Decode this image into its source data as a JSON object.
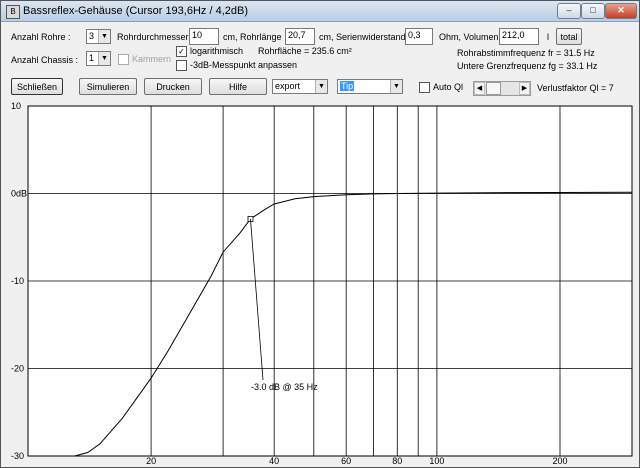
{
  "window": {
    "title": "Bassreflex-Gehäuse (Cursor 193,6Hz / 4,2dB)",
    "min_label": "–",
    "max_label": "□",
    "close_label": "✕"
  },
  "params": {
    "anzahl_rohre_label": "Anzahl Rohre :",
    "anzahl_rohre_value": "3",
    "rohrdurchmesser_label": "Rohrdurchmesser",
    "rohrdurchmesser_value": "10",
    "rohrlaenge_label": "cm, Rohrlänge",
    "rohrlaenge_value": "20,7",
    "serienwiderstand_label": "cm, Serienwiderstand",
    "serienwiderstand_value": "0,3",
    "volumen_label": "Ohm, Volumen",
    "volumen_value": "212,0",
    "volumen_unit": "l",
    "total_label": "total",
    "anzahl_chassis_label": "Anzahl Chassis :",
    "anzahl_chassis_value": "1",
    "kammern_label": "Kammern",
    "logarithmisch_label": "logarithmisch",
    "messpunkt_label": "-3dB-Messpunkt anpassen",
    "rohrflaeche_text": "Rohrfläche = 235.6 cm²",
    "abstimmfrequenz_text": "Rohrabstimmfrequenz fr = 31.5 Hz",
    "grenzfrequenz_text": "Untere Grenzfrequenz fg = 33.1 Hz"
  },
  "toolbar": {
    "schliessen": "Schließen",
    "simulieren": "Simulieren",
    "drucken": "Drucken",
    "hilfe": "Hilfe",
    "export_value": "export",
    "tip_value": "Tip",
    "auto_ql_label": "Auto Ql",
    "verlustfaktor_text": "Verlustfaktor Ql = 7"
  },
  "chart_data": {
    "type": "line",
    "xscale": "log",
    "xlim": [
      10,
      300
    ],
    "ylim": [
      -30,
      10
    ],
    "y_ticks": [
      10,
      0,
      -10,
      -20,
      -30
    ],
    "y_tick_labels": [
      "10",
      "0dB",
      "-10",
      "-20",
      "-30"
    ],
    "x_tick_labels": [
      {
        "v": 20,
        "label": "20"
      },
      {
        "v": 40,
        "label": "40"
      },
      {
        "v": 60,
        "label": "60"
      },
      {
        "v": 80,
        "label": "80"
      },
      {
        "v": 100,
        "label": "100"
      },
      {
        "v": 200,
        "label": "200"
      }
    ],
    "x_grid": [
      20,
      30,
      40,
      50,
      60,
      70,
      80,
      90,
      100,
      200
    ],
    "series": [
      {
        "x": [
          10,
          13,
          14,
          15,
          17,
          20,
          22,
          25,
          28,
          30,
          33,
          35,
          38,
          40,
          45,
          50,
          60,
          70,
          80,
          100,
          150,
          200,
          300
        ],
        "y": [
          -30,
          -30,
          -29.6,
          -28.6,
          -25.7,
          -21.1,
          -18.0,
          -13.5,
          -9.5,
          -6.7,
          -4.5,
          -2.9,
          -1.8,
          -1.2,
          -0.6,
          -0.35,
          -0.15,
          -0.05,
          0,
          0.05,
          0.1,
          0.12,
          0.15
        ]
      }
    ],
    "annotation": {
      "label": "-3.0 dB @  35 Hz",
      "x": 35,
      "y": -2.9
    }
  }
}
